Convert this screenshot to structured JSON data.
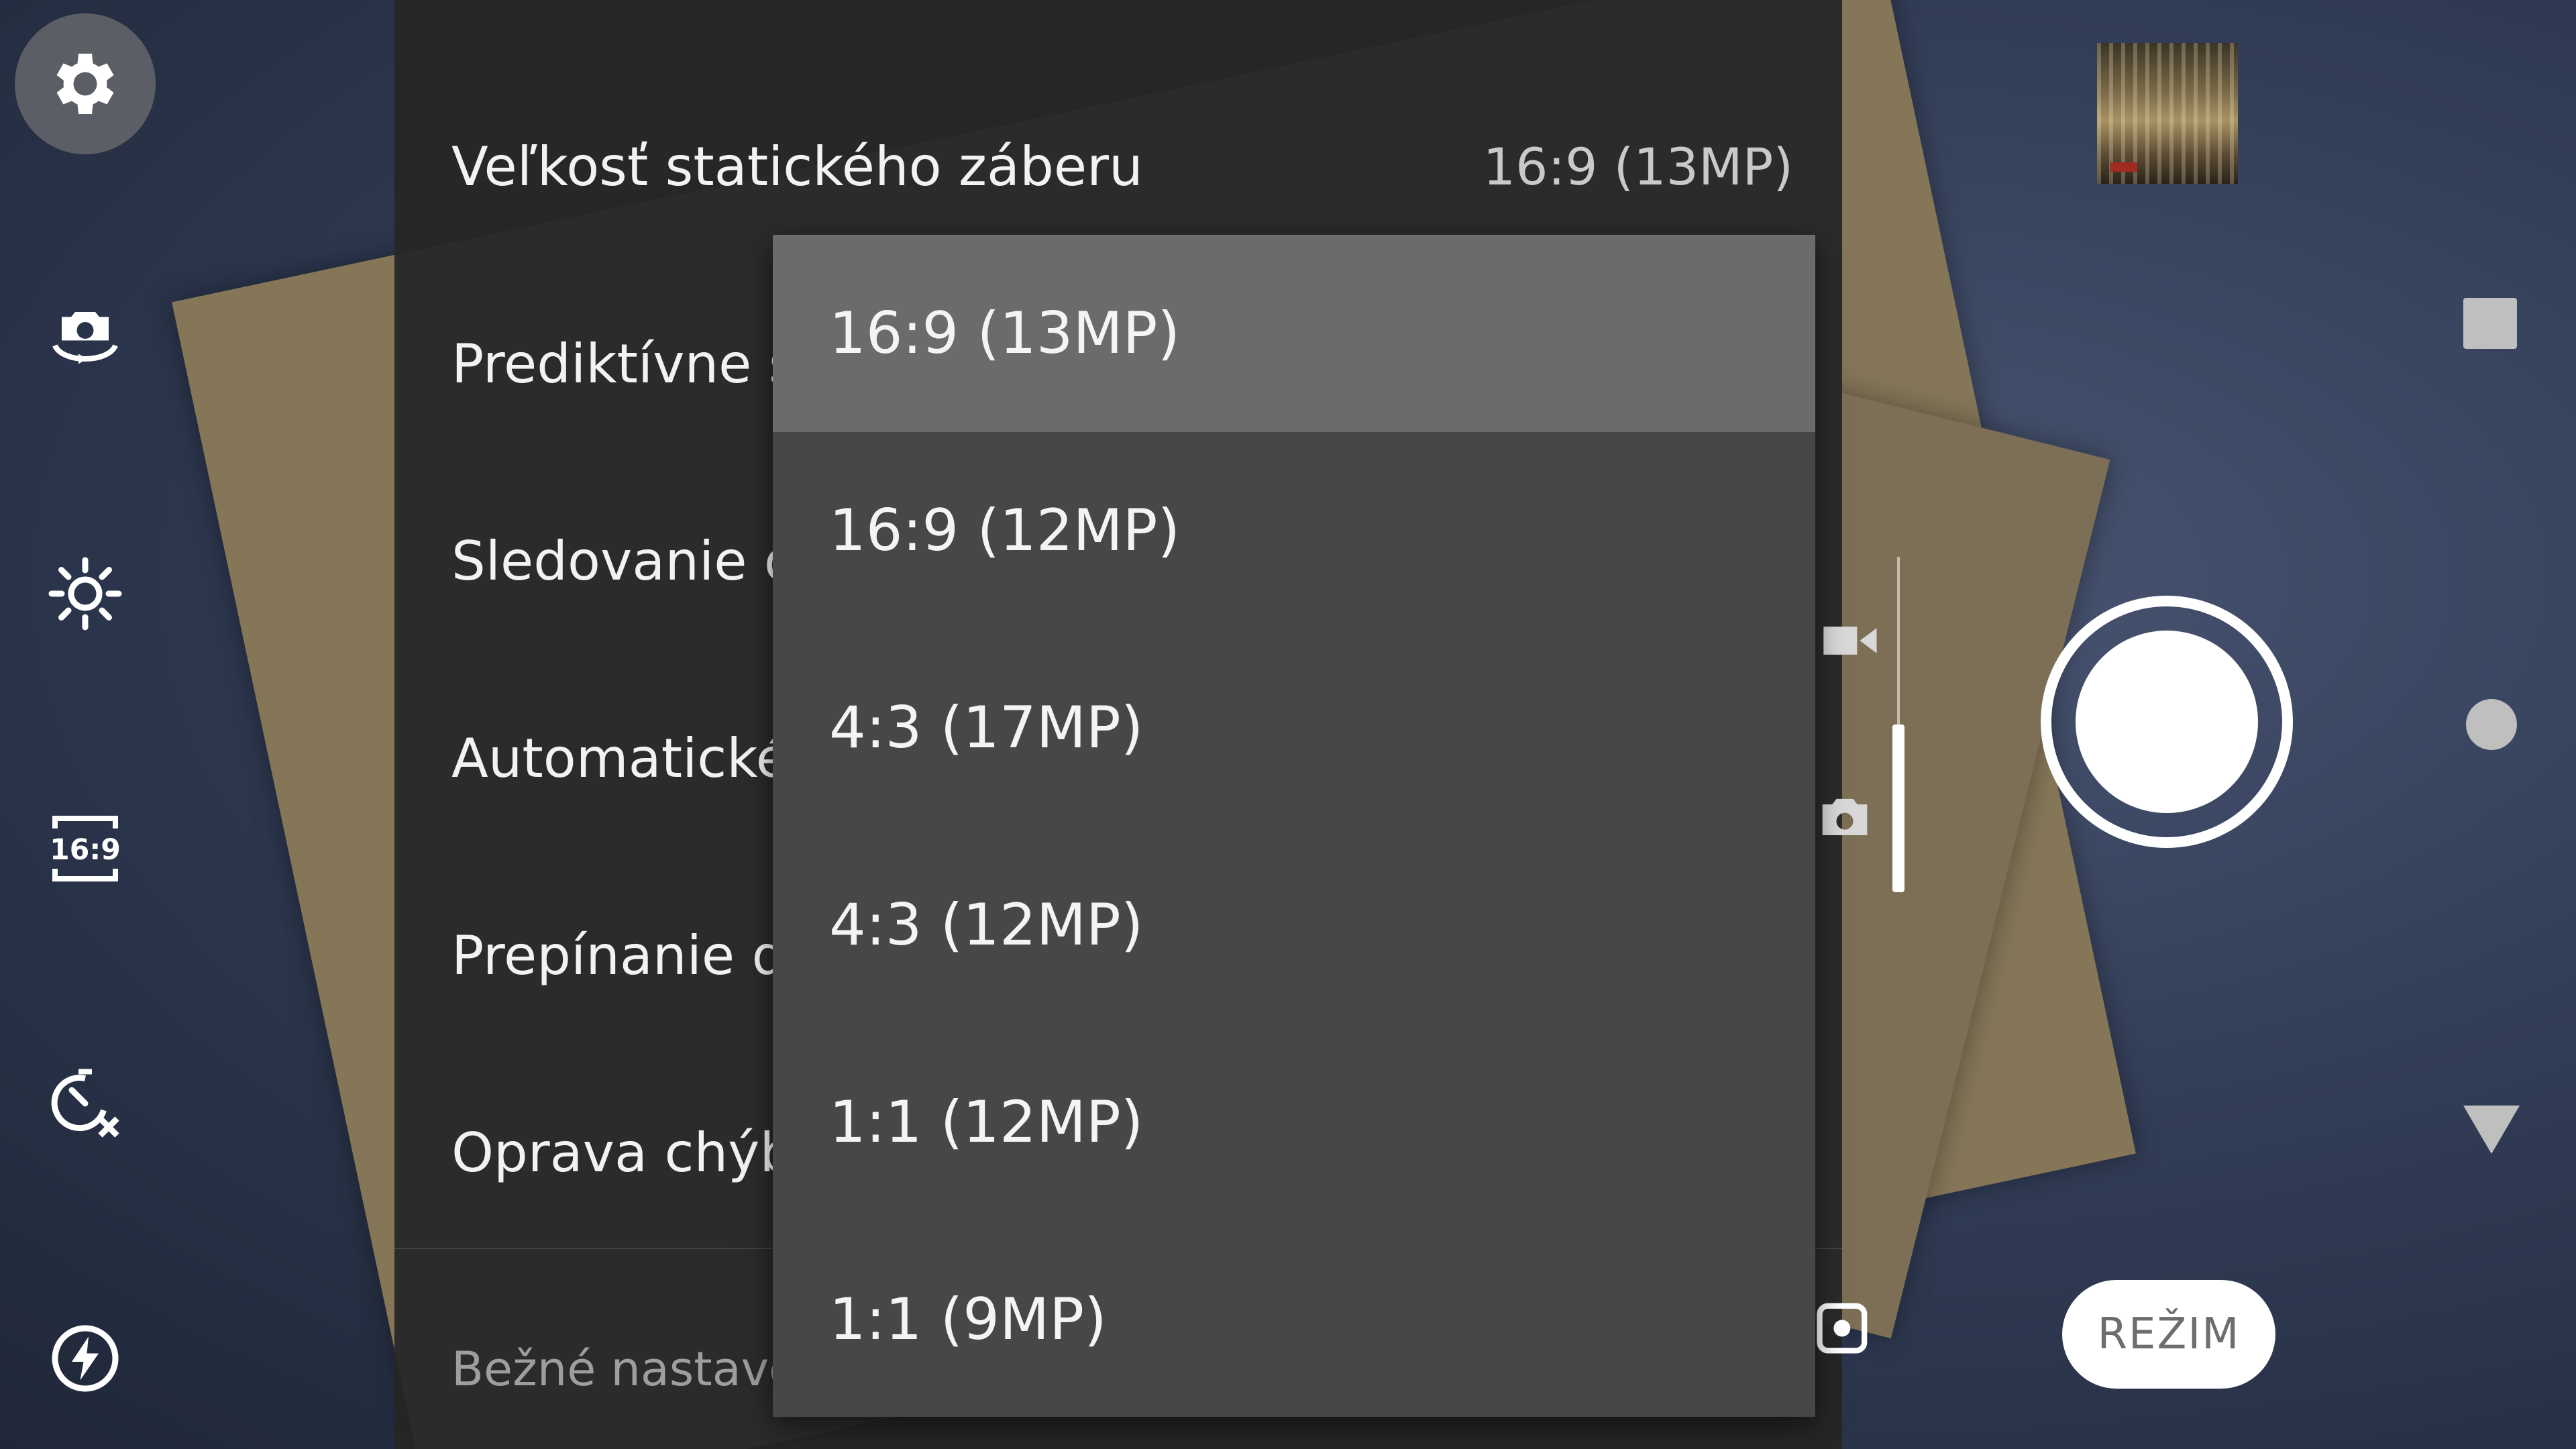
{
  "settings": {
    "rows": [
      {
        "label": "Veľkosť statického záberu",
        "value": "16:9 (13MP)"
      },
      {
        "label": "Prediktívne s",
        "value": ""
      },
      {
        "label": "Sledovanie o",
        "value": ""
      },
      {
        "label": "Automatické",
        "value": ""
      },
      {
        "label": "Prepínanie du",
        "value": ""
      },
      {
        "label": "Oprava chýb",
        "value": ""
      }
    ],
    "section_label": "Bežné nastaven"
  },
  "dropdown": {
    "selected_index": 0,
    "options": [
      "16:9 (13MP)",
      "16:9 (12MP)",
      "4:3 (17MP)",
      "4:3 (12MP)",
      "1:1 (12MP)",
      "1:1 (9MP)"
    ]
  },
  "left_rail": {
    "aspect_label": "16:9",
    "icons": [
      "gear-icon",
      "switch-camera-icon",
      "brightness-icon",
      "aspect-ratio-icon",
      "timer-off-icon",
      "flash-auto-icon"
    ]
  },
  "right_controls": {
    "mode_label": "REŽIM"
  }
}
